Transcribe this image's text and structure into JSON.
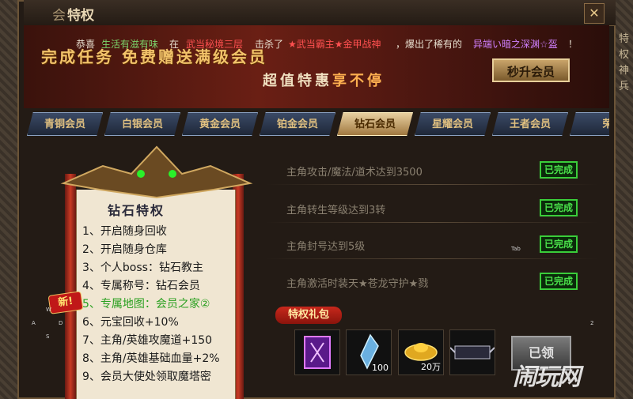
{
  "window": {
    "title_prefix": "会",
    "title": "特权",
    "close_label": "✕"
  },
  "right_tabs": [
    "特",
    "权",
    "",
    "神",
    "兵"
  ],
  "banner": {
    "headline": "完成任务 免费赠送满级会员",
    "sub_prefix": "超值特惠",
    "sub_highlight": "享不停",
    "upgrade_button": "秒升会员"
  },
  "marquee": {
    "p1": "恭喜",
    "player": "生活有滋有味",
    "p2": "在",
    "location": "武当秘境三层",
    "p3": "击杀了",
    "boss": "★武当霸主★金甲战神",
    "p4": "，爆出了稀有的",
    "item": "异端い暗之深渊☆盔",
    "p5": "！"
  },
  "tabs": [
    {
      "label": "青铜会员",
      "active": false
    },
    {
      "label": "白银会员",
      "active": false
    },
    {
      "label": "黄金会员",
      "active": false
    },
    {
      "label": "铂金会员",
      "active": false
    },
    {
      "label": "钻石会员",
      "active": true
    },
    {
      "label": "星耀会员",
      "active": false
    },
    {
      "label": "王者会员",
      "active": false
    },
    {
      "label": "荣",
      "active": false
    }
  ],
  "perks_panel": {
    "title": "钻石特权",
    "new_badge": "新!",
    "items": [
      "1、开启随身回收",
      "2、开启随身仓库",
      "3、个人boss：钻石教主",
      "4、专属称号：钻石会员",
      "5、专属地图：会员之家②",
      "6、元宝回收+10%",
      "7、主角/英雄攻魔道+150",
      "8、主角/英雄基础血量+2%",
      "9、会员大使处领取魔塔密"
    ]
  },
  "tasks": [
    {
      "label": "主角攻击/魔法/道术达到3500",
      "status": "已完成"
    },
    {
      "label": "主角转生等级达到3转",
      "status": "已完成"
    },
    {
      "label": "主角封号达到5级",
      "status": "已完成"
    },
    {
      "label": "主角激活时装天★苍龙守护★戮",
      "status": "已完成"
    }
  ],
  "gift_pack": {
    "label": "特权礼包",
    "items": [
      {
        "name": "purple-skill-book",
        "qty": ""
      },
      {
        "name": "crystal-shard",
        "qty": "100"
      },
      {
        "name": "gold-ingot",
        "qty": "20万"
      },
      {
        "name": "title-badge",
        "qty": ""
      }
    ],
    "claim_button": "已领"
  },
  "hotkeys": {
    "w": "W",
    "a": "A",
    "d": "D",
    "s": "S",
    "tab": "Tab",
    "two": "2"
  },
  "watermark": "闹玩网"
}
